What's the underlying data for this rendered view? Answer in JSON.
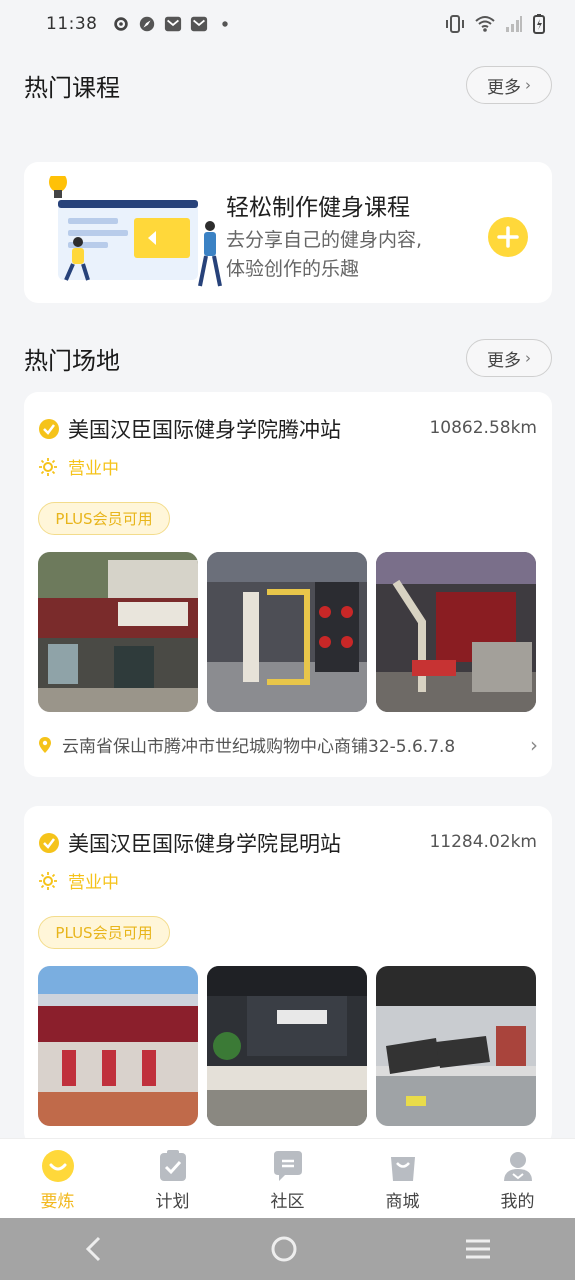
{
  "status_bar": {
    "time": "11:38"
  },
  "hot_courses": {
    "title": "热门课程",
    "more_label": "更多"
  },
  "promo": {
    "title": "轻松制作健身课程",
    "subtitle_line1": "去分享自己的健身内容,",
    "subtitle_line2": "体验创作的乐趣"
  },
  "hot_venues": {
    "title": "热门场地",
    "more_label": "更多"
  },
  "venues": [
    {
      "name": "美国汉臣国际健身学院腾冲站",
      "distance": "10862.58km",
      "status": "营业中",
      "badge": "PLUS会员可用",
      "address": "云南省保山市腾冲市世纪城购物中心商铺32-5.6.7.8"
    },
    {
      "name": "美国汉臣国际健身学院昆明站",
      "distance": "11284.02km",
      "status": "营业中",
      "badge": "PLUS会员可用"
    }
  ],
  "tabs": [
    {
      "label": "要炼",
      "icon": "smile-icon",
      "active": true
    },
    {
      "label": "计划",
      "icon": "clipboard-check-icon",
      "active": false
    },
    {
      "label": "社区",
      "icon": "chat-bubble-icon",
      "active": false
    },
    {
      "label": "商城",
      "icon": "shopping-bag-icon",
      "active": false
    },
    {
      "label": "我的",
      "icon": "user-icon",
      "active": false
    }
  ],
  "colors": {
    "accent": "#F5C31A",
    "background": "#F4F5F7"
  }
}
